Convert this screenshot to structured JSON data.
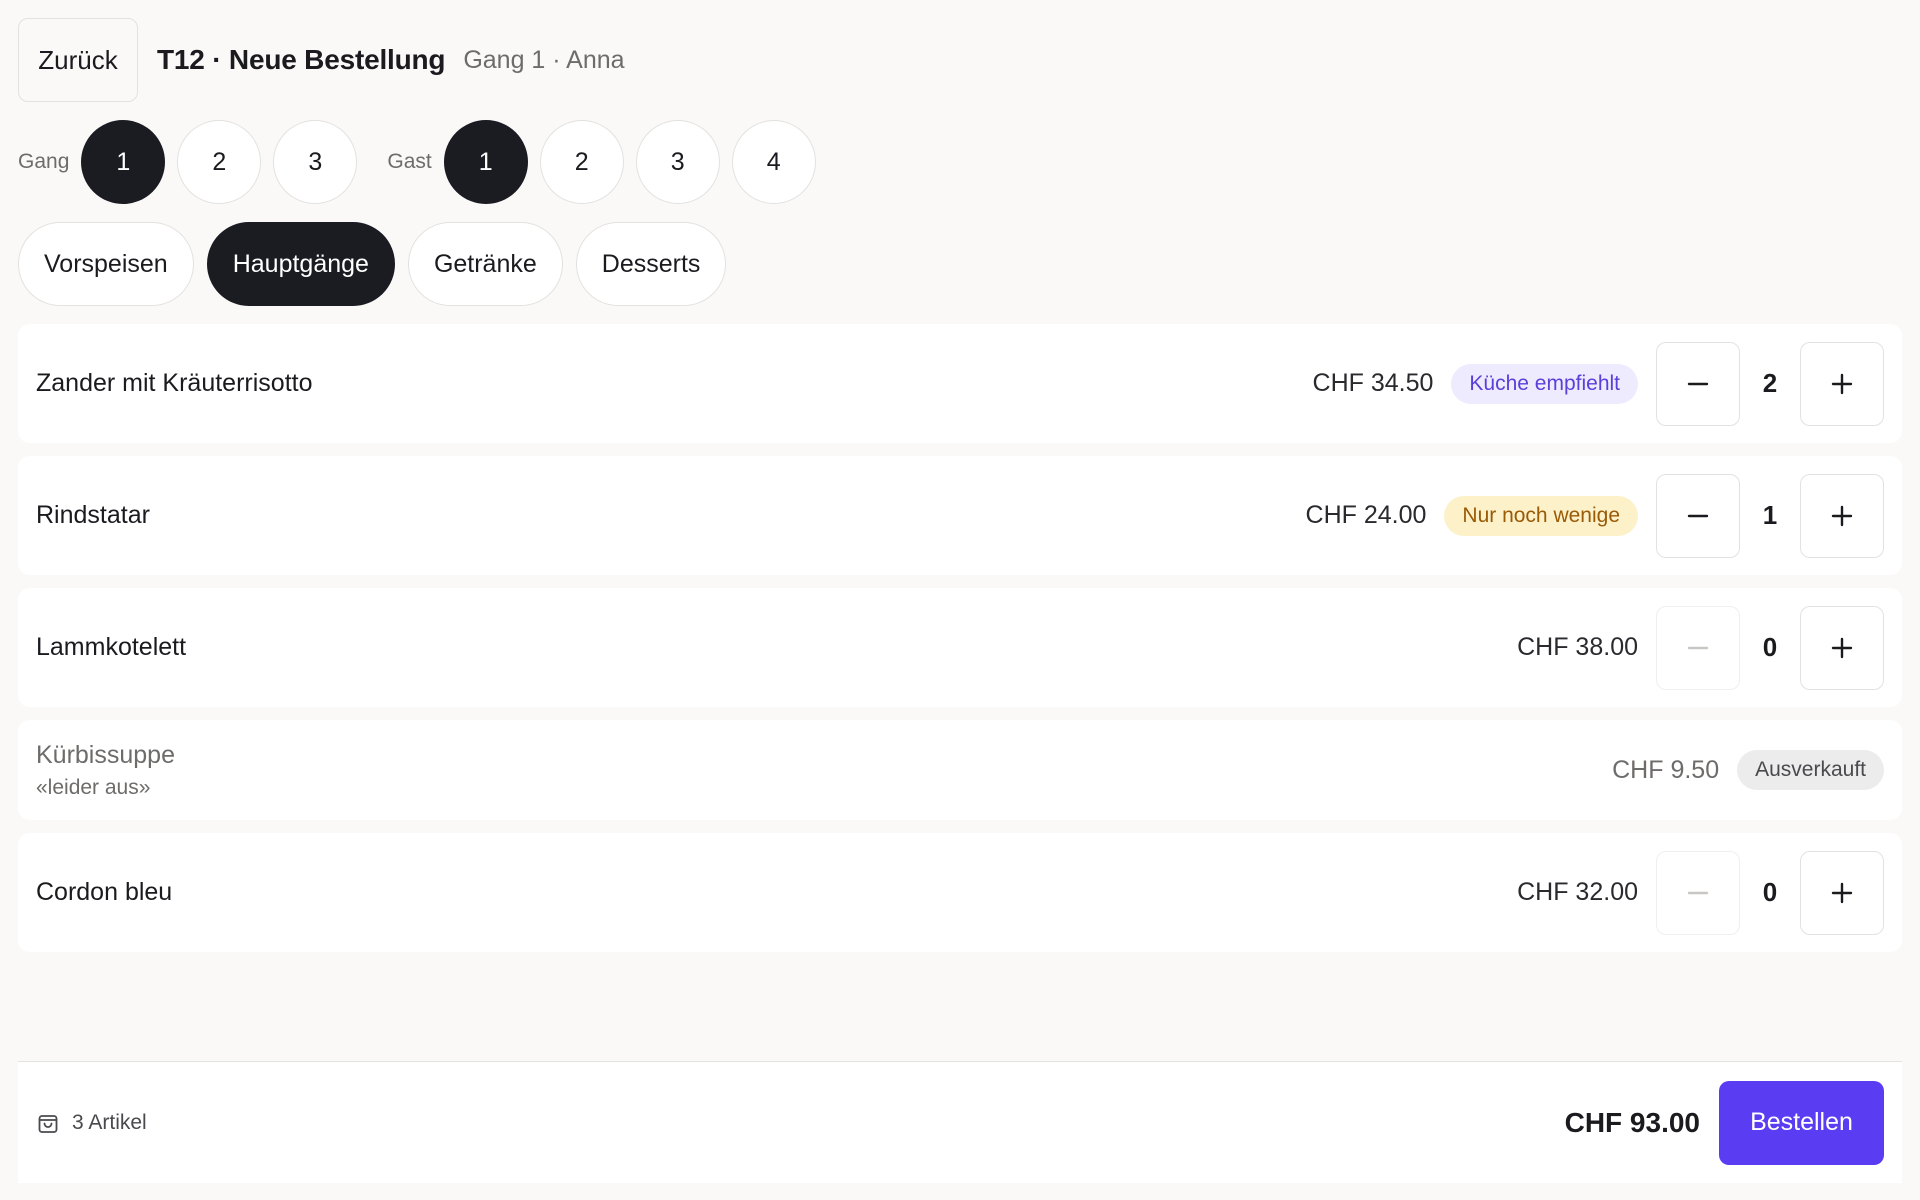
{
  "header": {
    "back_label": "Zurück",
    "title": "T12 · Neue Bestellung",
    "subtitle": "Gang 1 · Anna"
  },
  "course_selector": {
    "label": "Gang",
    "options": [
      "1",
      "2",
      "3"
    ],
    "selected": "1"
  },
  "guest_selector": {
    "label": "Gast",
    "options": [
      "1",
      "2",
      "3",
      "4"
    ],
    "selected": "1"
  },
  "tabs": [
    {
      "label": "Vorspeisen",
      "active": false
    },
    {
      "label": "Hauptgänge",
      "active": true
    },
    {
      "label": "Getränke",
      "active": false
    },
    {
      "label": "Desserts",
      "active": false
    }
  ],
  "items": [
    {
      "name": "Zander mit Kräuterrisotto",
      "price": "CHF 34.50",
      "badge": "Küche empfiehlt",
      "quantity": "2"
    },
    {
      "name": "Rindstatar",
      "price": "CHF 24.00",
      "badge": "Nur noch wenige",
      "quantity": "1"
    },
    {
      "name": "Lammkotelett",
      "price": "CHF 38.00",
      "quantity": "0"
    },
    {
      "name": "Kürbissuppe",
      "note": "«leider aus»",
      "price": "CHF 9.50",
      "badge": "Ausverkauft"
    },
    {
      "name": "Cordon bleu",
      "price": "CHF 32.00",
      "quantity": "0"
    }
  ],
  "footer": {
    "item_count": "3 Artikel",
    "total": "CHF 93.00",
    "order_label": "Bestellen"
  },
  "colors": {
    "accent": "#5a3df2",
    "active_chip": "#1b1b22",
    "badge_recommend_bg": "#efebfe",
    "badge_recommend_text": "#5a3fd9",
    "badge_low_bg": "#fdf1c9",
    "badge_low_text": "#9a5a06",
    "badge_soldout_bg": "#ececec"
  },
  "icons": {
    "cart": "shopping-bag-icon",
    "minus": "minus-icon",
    "plus": "plus-icon"
  }
}
